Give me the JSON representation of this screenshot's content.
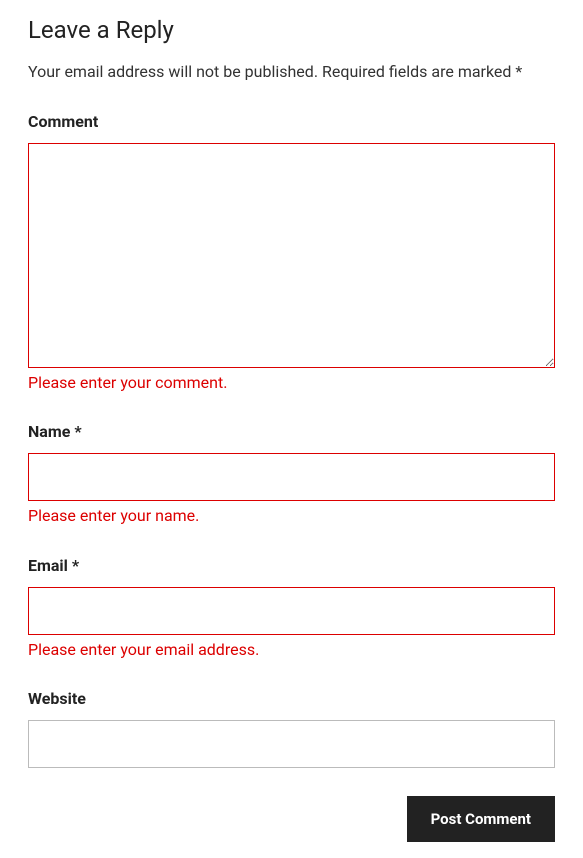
{
  "heading": "Leave a Reply",
  "notice": "Your email address will not be published. Required fields are marked *",
  "fields": {
    "comment": {
      "label": "Comment",
      "error": "Please enter your comment."
    },
    "name": {
      "label": "Name ",
      "required": "*",
      "error": "Please enter your name."
    },
    "email": {
      "label": "Email ",
      "required": "*",
      "error": "Please enter your email address."
    },
    "website": {
      "label": "Website"
    }
  },
  "submit": {
    "label": "Post Comment"
  }
}
